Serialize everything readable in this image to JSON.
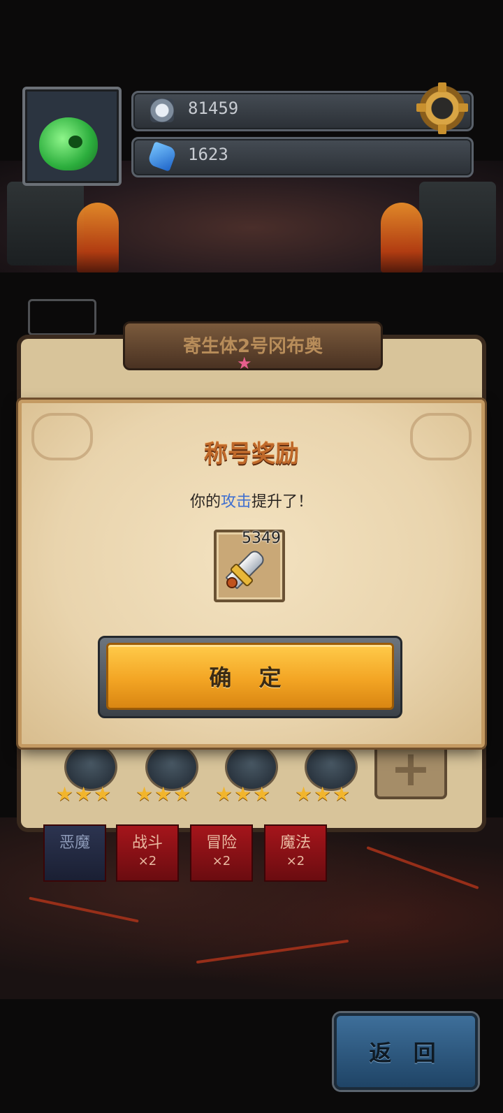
{
  "hud": {
    "soul_count": "81459",
    "gem_count": "1623",
    "icons": {
      "soul": "skull-token-icon",
      "gem": "blue-gem-icon",
      "settings": "gear-icon",
      "avatar": "green-slime-avatar"
    }
  },
  "title_plate": {
    "name": "寄生体2号冈布奥"
  },
  "flags": [
    {
      "label": "恶魔",
      "multiplier": ""
    },
    {
      "label": "战斗",
      "multiplier": "×2"
    },
    {
      "label": "冒险",
      "multiplier": "×2"
    },
    {
      "label": "魔法",
      "multiplier": "×2"
    }
  ],
  "emblems": [
    {
      "stars": "★★★"
    },
    {
      "stars": "★★★"
    },
    {
      "stars": "★★★"
    },
    {
      "stars": "★★★"
    }
  ],
  "dialog": {
    "title": "称号奖励",
    "message_prefix": "你的",
    "message_highlight": "攻击",
    "message_suffix": "提升了！",
    "reward": {
      "icon": "sword-icon",
      "value": "5349"
    },
    "confirm_label": "确 定"
  },
  "back_label": "返 回",
  "colors": {
    "highlight": "#3f6fd0",
    "confirm_button": "#f3a524",
    "back_button": "#2f5a80",
    "title_text": "#c0692a"
  }
}
